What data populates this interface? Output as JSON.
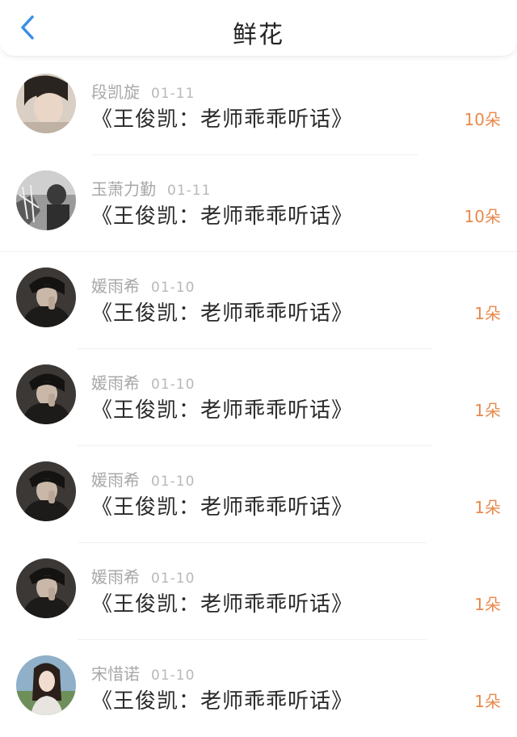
{
  "header": {
    "title": "鲜花",
    "back_icon": "chevron-left-icon",
    "accent_color": "#3a8ee6"
  },
  "list": [
    {
      "user": "段凯旋",
      "date": "01-11",
      "title": "《王俊凯：老师乖乖听话》",
      "count": "10朵",
      "avatar": "portrait-light"
    },
    {
      "user": "玉萧力勤",
      "date": "01-11",
      "title": "《王俊凯：老师乖乖听话》",
      "count": "10朵",
      "avatar": "portrait-grayscale"
    },
    {
      "user": "媛雨希",
      "date": "01-10",
      "title": "《王俊凯：老师乖乖听话》",
      "count": "1朵",
      "avatar": "portrait-dark"
    },
    {
      "user": "媛雨希",
      "date": "01-10",
      "title": "《王俊凯：老师乖乖听话》",
      "count": "1朵",
      "avatar": "portrait-dark"
    },
    {
      "user": "媛雨希",
      "date": "01-10",
      "title": "《王俊凯：老师乖乖听话》",
      "count": "1朵",
      "avatar": "portrait-dark"
    },
    {
      "user": "媛雨希",
      "date": "01-10",
      "title": "《王俊凯：老师乖乖听话》",
      "count": "1朵",
      "avatar": "portrait-dark"
    },
    {
      "user": "宋惜诺",
      "date": "01-10",
      "title": "《王俊凯：老师乖乖听话》",
      "count": "1朵",
      "avatar": "portrait-outdoor"
    }
  ],
  "colors": {
    "count": "#e8894c",
    "meta": "#a8a8a8",
    "title": "#2a2a2a"
  }
}
